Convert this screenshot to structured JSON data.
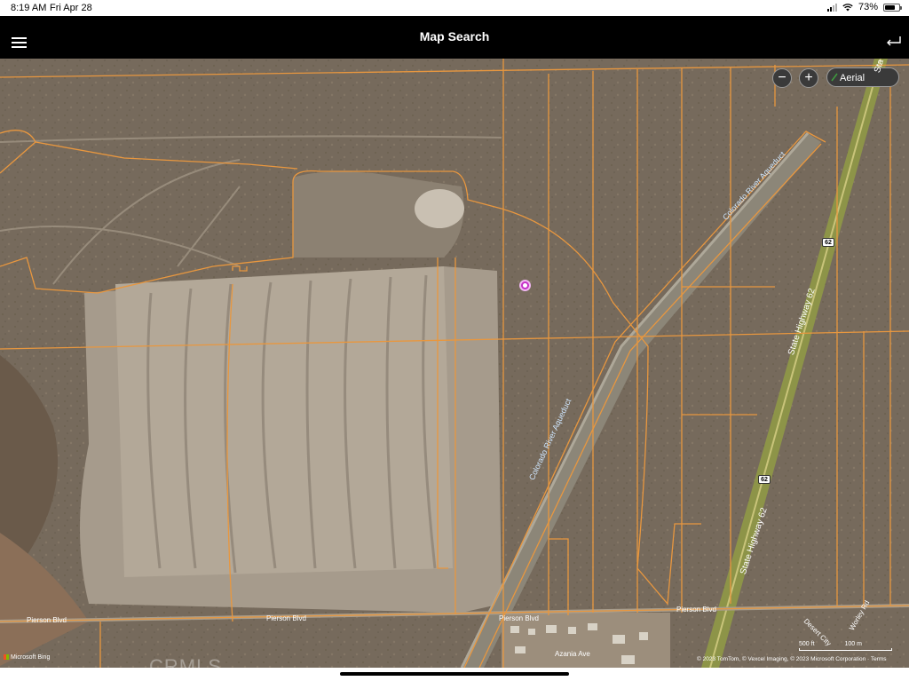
{
  "status_bar": {
    "time": "8:19 AM",
    "date": "Fri Apr 28",
    "battery": "73%",
    "battery_level": 0.73
  },
  "nav": {
    "title": "Map Search",
    "menu_icon": "hamburger-menu-icon",
    "back_icon": "return-arrow-icon"
  },
  "map_controls": {
    "zoom_out": "−",
    "zoom_in": "+",
    "layer_label": "Aerial"
  },
  "streets": {
    "pierson_left": "Pierson Blvd",
    "pierson_mid": "Pierson Blvd",
    "pierson_center": "Pierson Blvd",
    "pierson_right": "Pierson Blvd",
    "azania": "Azania Ave",
    "worley": "Worley Rd",
    "desert": "Desert City",
    "aqueduct_upper": "Colorado River Aqueduct",
    "aqueduct_lower": "Colorado River Aqueduct",
    "highway_upper": "State Highway 62",
    "highway_lower": "State Highway 62",
    "highway_top": "Sta",
    "shield_upper": "62",
    "shield_lower": "62"
  },
  "attribution": {
    "logo": "Microsoft Bing",
    "watermark": "CRMLS",
    "copyright": "© 2023 TomTom, © Vexcel Imaging, © 2023 Microsoft Corporation · Terms",
    "scale_left": "500 ft",
    "scale_right": "100 m"
  },
  "colors": {
    "parcel_line": "#e8973f",
    "pin": "#c530c8",
    "nav_bg": "#000000",
    "highway": "#8d9448"
  }
}
